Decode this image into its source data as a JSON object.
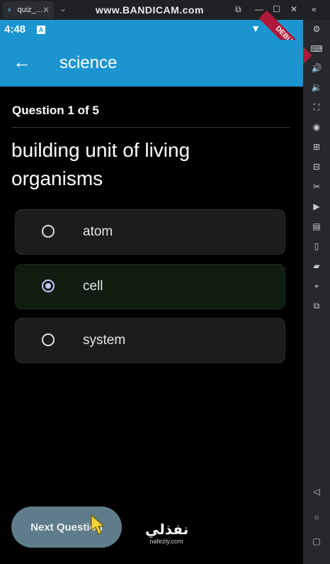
{
  "window": {
    "tab_title": "quiz_...",
    "watermark": "www.BANDICAM.com"
  },
  "statusbar": {
    "time": "4:48",
    "debug_banner": "DEBUG"
  },
  "appbar": {
    "title": "science"
  },
  "quiz": {
    "progress_label": "Question 1 of 5",
    "question": "building unit of living organisms",
    "options": [
      {
        "label": "atom",
        "selected": false
      },
      {
        "label": "cell",
        "selected": true
      },
      {
        "label": "system",
        "selected": false
      }
    ],
    "next_button": "Next Question"
  },
  "overlay": {
    "brand_arabic": "نفذلي",
    "brand_domain": "nafezly.com"
  },
  "colors": {
    "appbar": "#1b95d0",
    "selected_option": "#0f1d10",
    "button": "#5f7c8a"
  }
}
